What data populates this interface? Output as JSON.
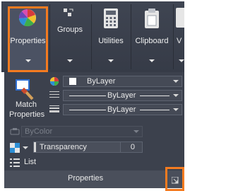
{
  "ribbon": {
    "buttons": [
      {
        "label": "Properties",
        "icon": "color-wheel-icon"
      },
      {
        "label": "Groups",
        "icon": "groups-icon"
      },
      {
        "label": "Utilities",
        "icon": "calculator-icon"
      },
      {
        "label": "Clipboard",
        "icon": "clipboard-icon"
      },
      {
        "label": "V",
        "icon": "view-icon"
      }
    ]
  },
  "panel": {
    "match_properties": {
      "line1": "Match",
      "line2": "Properties"
    },
    "color": {
      "value": "ByLayer"
    },
    "linetype": {
      "value": "ByLayer"
    },
    "lineweight": {
      "value": "ByLayer"
    },
    "plot_style": {
      "value": "ByColor"
    },
    "transparency": {
      "label": "Transparency",
      "value": "0"
    },
    "list_label": "List",
    "title": "Properties"
  },
  "colors": {
    "accent": "#f47b20",
    "ribbon_bg": "#3f4552",
    "panel_bg": "#3c414d"
  }
}
